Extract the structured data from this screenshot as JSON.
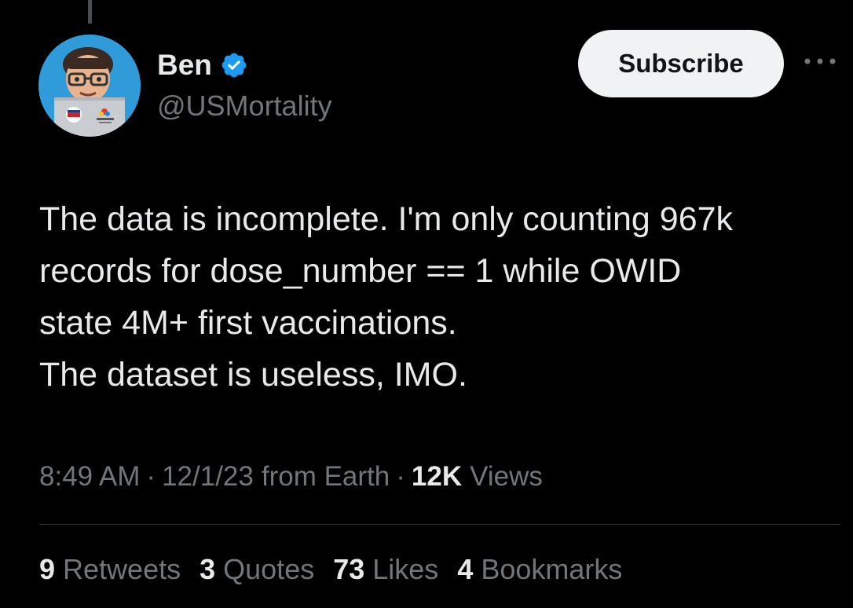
{
  "author": {
    "display_name": "Ben",
    "handle": "@USMortality",
    "verified": true,
    "avatar_icon": "memoji-avatar-with-glasses-and-laptop"
  },
  "actions": {
    "subscribe_label": "Subscribe",
    "more_icon": "more-horizontal-icon"
  },
  "tweet": {
    "lines": [
      "The data is incomplete. I'm only counting 967k",
      "records for dose_number == 1 while OWID",
      "state 4M+ first vaccinations.",
      "The dataset is useless, IMO."
    ]
  },
  "meta": {
    "time": "8:49 AM",
    "date": "12/1/23",
    "source": "from Earth",
    "separator": "·",
    "views_count": "12K",
    "views_label": "Views"
  },
  "stats": [
    {
      "count": "9",
      "label": "Retweets"
    },
    {
      "count": "3",
      "label": "Quotes"
    },
    {
      "count": "73",
      "label": "Likes"
    },
    {
      "count": "4",
      "label": "Bookmarks"
    }
  ],
  "colors": {
    "background": "#000000",
    "primary_text": "#e7e9ea",
    "secondary_text": "#71767b",
    "verified_blue": "#1d9bf0",
    "button_bg": "#eff3f4",
    "divider": "#2f3336"
  }
}
